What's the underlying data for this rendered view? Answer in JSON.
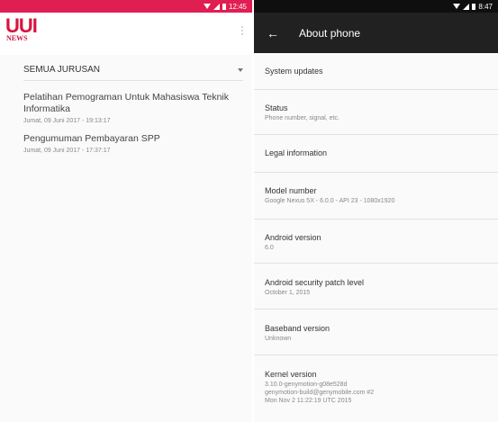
{
  "left_screen": {
    "status_time": "12:45",
    "logo": {
      "text": "UUI",
      "subtext": "NEWS"
    },
    "filter": {
      "selected": "SEMUA JURUSAN"
    },
    "news": [
      {
        "title": "Pelatihan Pemograman Untuk Mahasiswa Teknik Informatika",
        "date": "Jumat, 09 Juni 2017 - 19:13:17"
      },
      {
        "title": "Pengumuman Pembayaran SPP",
        "date": "Jumat, 09 Juni 2017 - 17:37:17"
      }
    ],
    "colors": {
      "status_bar": "#e01e52",
      "brand": "#d7143f"
    }
  },
  "right_screen": {
    "status_time": "8:47",
    "title": "About phone",
    "back_icon": "arrow-back-icon",
    "items": [
      {
        "title": "System updates",
        "subtitle": ""
      },
      {
        "title": "Status",
        "subtitle": "Phone number, signal, etc."
      },
      {
        "title": "Legal information",
        "subtitle": ""
      },
      {
        "title": "Model number",
        "subtitle": "Google Nexus 5X - 6.0.0 - API 23 - 1080x1920"
      },
      {
        "title": "Android version",
        "subtitle": "6.0"
      },
      {
        "title": "Android security patch level",
        "subtitle": "October 1, 2015"
      },
      {
        "title": "Baseband version",
        "subtitle": "Unknown"
      },
      {
        "title": "Kernel version",
        "subtitle": "3.10.0-genymotion-g08e528d",
        "subtitle2": "genymotion-build@genymobile.com #2",
        "subtitle3": "Mon Nov 2 11:22:19 UTC 2015"
      }
    ],
    "colors": {
      "app_bar": "#212121",
      "status_bar": "#0f0f0f"
    }
  }
}
